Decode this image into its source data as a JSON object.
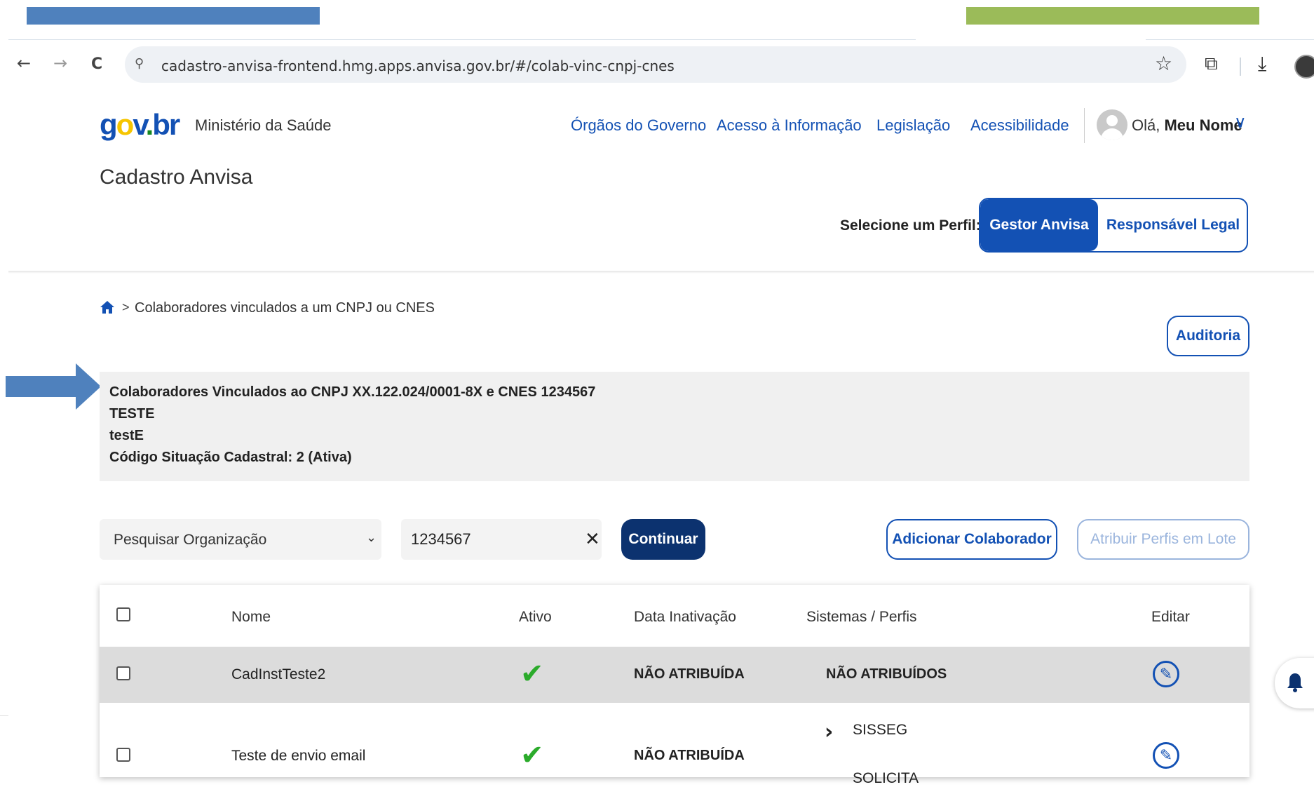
{
  "browser": {
    "url": "cadastro-anvisa-frontend.hmg.apps.anvisa.gov.br/#/colab-vinc-cnpj-cnes",
    "back_icon": "arrow-left-icon",
    "forward_icon": "arrow-right-icon",
    "reload_icon": "reload-icon",
    "back_glyph": "←",
    "forward_glyph": "→",
    "reload_glyph": "C",
    "site_info_glyph": "⚲",
    "star_glyph": "☆",
    "extension_glyph": "⧉",
    "download_glyph": "⤓"
  },
  "header": {
    "logo_text": {
      "g": "g",
      "o": "o",
      "v": "v",
      "dot": ".",
      "b": "b",
      "r": "r"
    },
    "ministry": "Ministério da Saúde",
    "links": [
      "Órgãos do Governo",
      "Acesso à Informação",
      "Legislação",
      "Acessibilidade"
    ],
    "greeting_prefix": "Olá,",
    "user_name": "Meu Nome",
    "chevron": "∨",
    "app_title": "Cadastro Anvisa",
    "perfil_label": "Selecione um Perfil:",
    "perfil_active": "Gestor Anvisa",
    "perfil_other": "Responsável Legal"
  },
  "breadcrumb": {
    "separator": ">",
    "current": "Colaboradores vinculados a um CNPJ ou CNES"
  },
  "auditoria_label": "Auditoria",
  "info": {
    "line1": "Colaboradores Vinculados ao CNPJ XX.122.024/0001-8X e CNES 1234567",
    "line2": "TESTE",
    "line3": "testE",
    "line4": "Código Situação Cadastral: 2 (Ativa)"
  },
  "filters": {
    "select_value": "Pesquisar Organização",
    "select_caret": "⌄",
    "search_value": "1234567",
    "clear_glyph": "✕",
    "continuar_label": "Continuar",
    "adicionar_label": "Adicionar Colaborador",
    "atribuir_label": "Atribuir Perfis em Lote"
  },
  "table": {
    "headers": [
      "Nome",
      "Ativo",
      "Data Inativação",
      "Sistemas / Perfis",
      "Editar"
    ],
    "rows": [
      {
        "nome": "CadInstTeste2",
        "ativo": "✔",
        "data": "NÃO ATRIBUÍDA",
        "sistemas": "NÃO ATRIBUÍDOS",
        "edit_glyph": "✎"
      },
      {
        "nome": "Teste de envio email",
        "ativo": "✔",
        "data": "NÃO ATRIBUÍDA",
        "sistemas": "SISSEG",
        "sistemas_next": "SOLICITA",
        "expand_glyph": "›",
        "edit_glyph": "✎"
      }
    ]
  },
  "notification": {
    "bell_glyph": "🔔"
  },
  "colors": {
    "primary": "#1351b4",
    "dark_button": "#0c326f",
    "success": "#2bab2b",
    "deco_blue": "#4f81bd",
    "deco_green": "#9bbb59"
  }
}
